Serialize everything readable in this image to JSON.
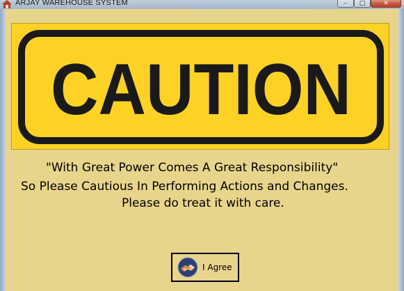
{
  "window": {
    "title": "ARJAY WAREHOUSE SYSTEM",
    "app_icon": "house-icon",
    "controls": {
      "minimize": "–",
      "maximize": "□",
      "close": "✕"
    }
  },
  "banner": {
    "text": "CAUTION",
    "colors": {
      "background": "#fdd225",
      "border_and_text": "#1a1a1a"
    }
  },
  "message": {
    "line1": "\"With Great Power Comes A Great Responsibility\"",
    "line2": "So Please Cautious In Performing Actions and Changes.",
    "line3": "Please do treat it with care."
  },
  "agree_button": {
    "label": "I Agree",
    "icon": "handshake-icon"
  },
  "colors": {
    "window_background": "#e8d58c"
  }
}
